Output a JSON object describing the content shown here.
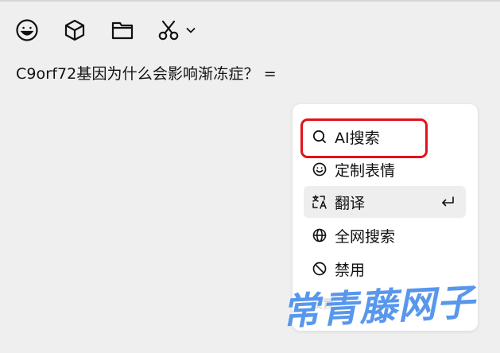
{
  "toolbar": {
    "buttons": [
      {
        "icon": "emoji-icon"
      },
      {
        "icon": "cube-icon"
      },
      {
        "icon": "folder-icon"
      },
      {
        "icon": "scissors-icon"
      },
      {
        "icon": "chevron-down-icon"
      }
    ]
  },
  "input": {
    "text": "C9orf72基因为什么会影响渐冻症？ ="
  },
  "context_menu": {
    "items": [
      {
        "label": "AI搜索",
        "icon": "search-icon"
      },
      {
        "label": "定制表情",
        "icon": "smile-icon"
      },
      {
        "label": "翻译",
        "icon": "translate-icon",
        "shortcut_icon": "enter-icon"
      },
      {
        "label": "全网搜索",
        "icon": "globe-icon"
      },
      {
        "label": "禁用",
        "icon": "ban-icon"
      }
    ],
    "footer_hint": "设置"
  },
  "watermark": "常青藤网子",
  "colors": {
    "background": "#efefef",
    "menu_bg": "#ffffff",
    "active_item_bg": "#eeeeee",
    "highlight_border": "#e3121c",
    "watermark": "#4a8eea"
  }
}
